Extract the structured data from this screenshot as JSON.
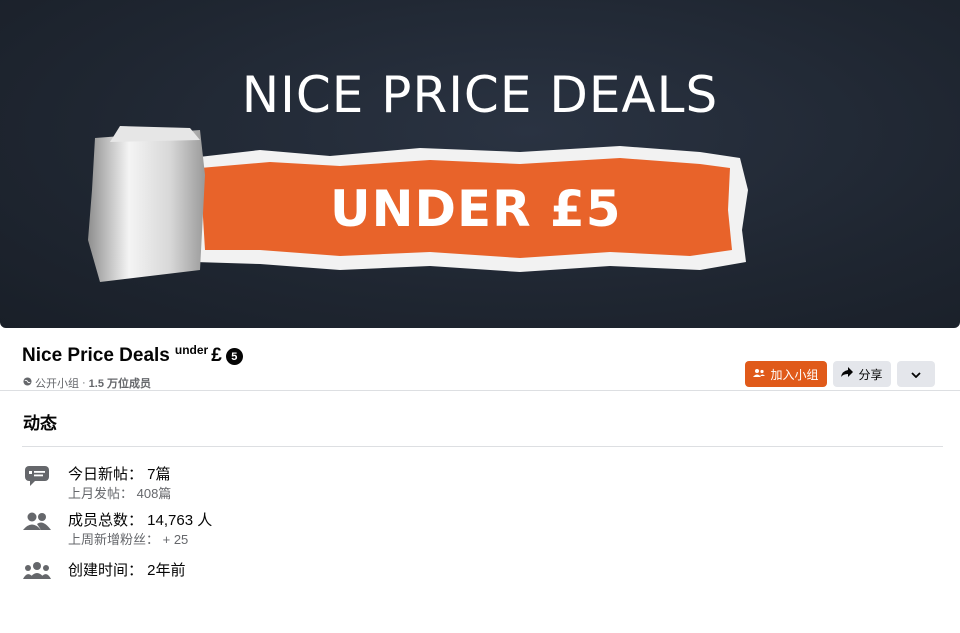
{
  "cover": {
    "title": "NICE PRICE DEALS",
    "subtitle": "UNDER £5",
    "colors": {
      "background": "#1f2631",
      "accent": "#e8632a",
      "paper": "#f2f2f2"
    }
  },
  "group": {
    "name": "Nice Price Deals",
    "name_superscript": "under",
    "currency": "£",
    "badge": "5",
    "privacy_icon": "globe-icon",
    "privacy": "公开小组",
    "separator": "·",
    "members_count": "1.5 万位成员"
  },
  "actions": {
    "join_label": "加入小组",
    "join_icon": "add-group-icon",
    "share_label": "分享",
    "share_icon": "share-arrow-icon",
    "more_icon": "chevron-down-icon",
    "join_color": "#e05a1a"
  },
  "activity": {
    "title": "动态",
    "stats": [
      {
        "icon": "chat-bubble-icon",
        "main": "今日新帖：  7篇",
        "sub": "上月发帖：  408篇"
      },
      {
        "icon": "people-icon",
        "main": "成员总数：  14,763 人",
        "sub": "上周新增粉丝：  + 25"
      },
      {
        "icon": "group-icon",
        "main": "创建时间：  2年前",
        "sub": ""
      }
    ]
  }
}
